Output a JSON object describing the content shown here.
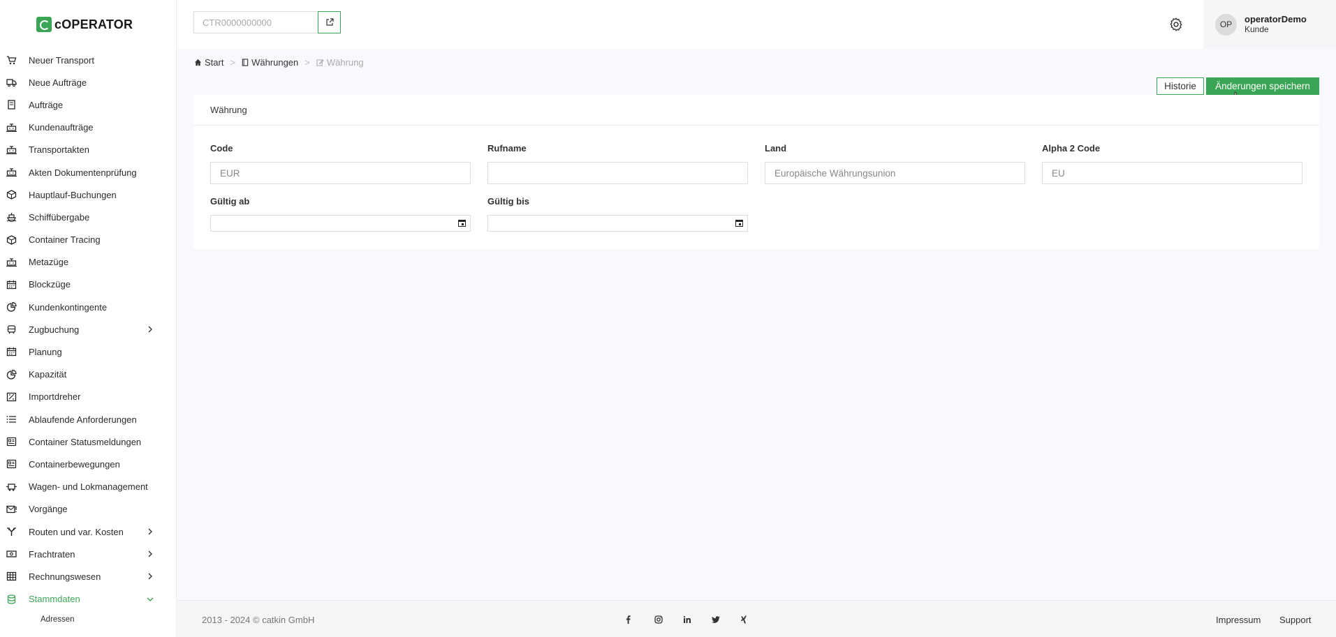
{
  "app": {
    "logo_text": "cOPERATOR"
  },
  "header": {
    "search_placeholder": "CTR0000000000",
    "user": {
      "initials": "OP",
      "name": "operatorDemo",
      "role": "Kunde"
    }
  },
  "sidebar": {
    "items": [
      {
        "label": "Neuer Transport",
        "icon": "cart-icon"
      },
      {
        "label": "Neue Aufträge",
        "icon": "truck-icon"
      },
      {
        "label": "Aufträge",
        "icon": "document-icon"
      },
      {
        "label": "Kundenaufträge",
        "icon": "train-icon"
      },
      {
        "label": "Transportakten",
        "icon": "train-icon"
      },
      {
        "label": "Akten Dokumentenprüfung",
        "icon": "train-icon"
      },
      {
        "label": "Hauptlauf-Buchungen",
        "icon": "box-icon"
      },
      {
        "label": "Schiffübergabe",
        "icon": "ship-icon"
      },
      {
        "label": "Container Tracing",
        "icon": "box-icon"
      },
      {
        "label": "Metazüge",
        "icon": "train-icon"
      },
      {
        "label": "Blockzüge",
        "icon": "calendar-icon"
      },
      {
        "label": "Kundenkontingente",
        "icon": "pie-icon"
      },
      {
        "label": "Zugbuchung",
        "icon": "train-front-icon",
        "has_children": true
      },
      {
        "label": "Planung",
        "icon": "calendar-icon"
      },
      {
        "label": "Kapazität",
        "icon": "pie-icon"
      },
      {
        "label": "Importdreher",
        "icon": "swap-icon"
      },
      {
        "label": "Ablaufende Anforderungen",
        "icon": "list-icon"
      },
      {
        "label": "Container Statusmeldungen",
        "icon": "news-icon"
      },
      {
        "label": "Containerbewegungen",
        "icon": "news-icon"
      },
      {
        "label": "Wagen- und Lokmanagement",
        "icon": "wagon-icon"
      },
      {
        "label": "Vorgänge",
        "icon": "mail-icon"
      },
      {
        "label": "Routen und var. Kosten",
        "icon": "route-icon",
        "has_children": true
      },
      {
        "label": "Frachtraten",
        "icon": "money-icon",
        "has_children": true
      },
      {
        "label": "Rechnungswesen",
        "icon": "grid-icon",
        "has_children": true
      },
      {
        "label": "Stammdaten",
        "icon": "database-icon",
        "expanded": true,
        "active": true
      }
    ],
    "sub_items": [
      {
        "label": "Adressen"
      }
    ]
  },
  "breadcrumb": {
    "home": "Start",
    "parent": "Währungen",
    "current": "Währung"
  },
  "actions": {
    "history_label": "Historie",
    "save_label": "Änderungen speichern"
  },
  "form": {
    "title": "Währung",
    "fields": {
      "code": {
        "label": "Code",
        "value": "EUR"
      },
      "rufname": {
        "label": "Rufname",
        "value": ""
      },
      "land": {
        "label": "Land",
        "value": "Europäische Währungsunion"
      },
      "alpha2": {
        "label": "Alpha 2 Code",
        "value": "EU"
      },
      "gueltig_ab": {
        "label": "Gültig ab",
        "value": ""
      },
      "gueltig_bis": {
        "label": "Gültig bis",
        "value": ""
      }
    }
  },
  "footer": {
    "copyright": "2013 - 2024 © catkin GmbH",
    "socials": [
      "facebook-icon",
      "instagram-icon",
      "linkedin-icon",
      "twitter-icon",
      "xing-icon"
    ],
    "links": {
      "impressum": "Impressum",
      "support": "Support"
    }
  },
  "colors": {
    "accent": "#3aa655",
    "text": "#333333",
    "muted": "#aaaaaa",
    "background": "#f8f9fc"
  }
}
